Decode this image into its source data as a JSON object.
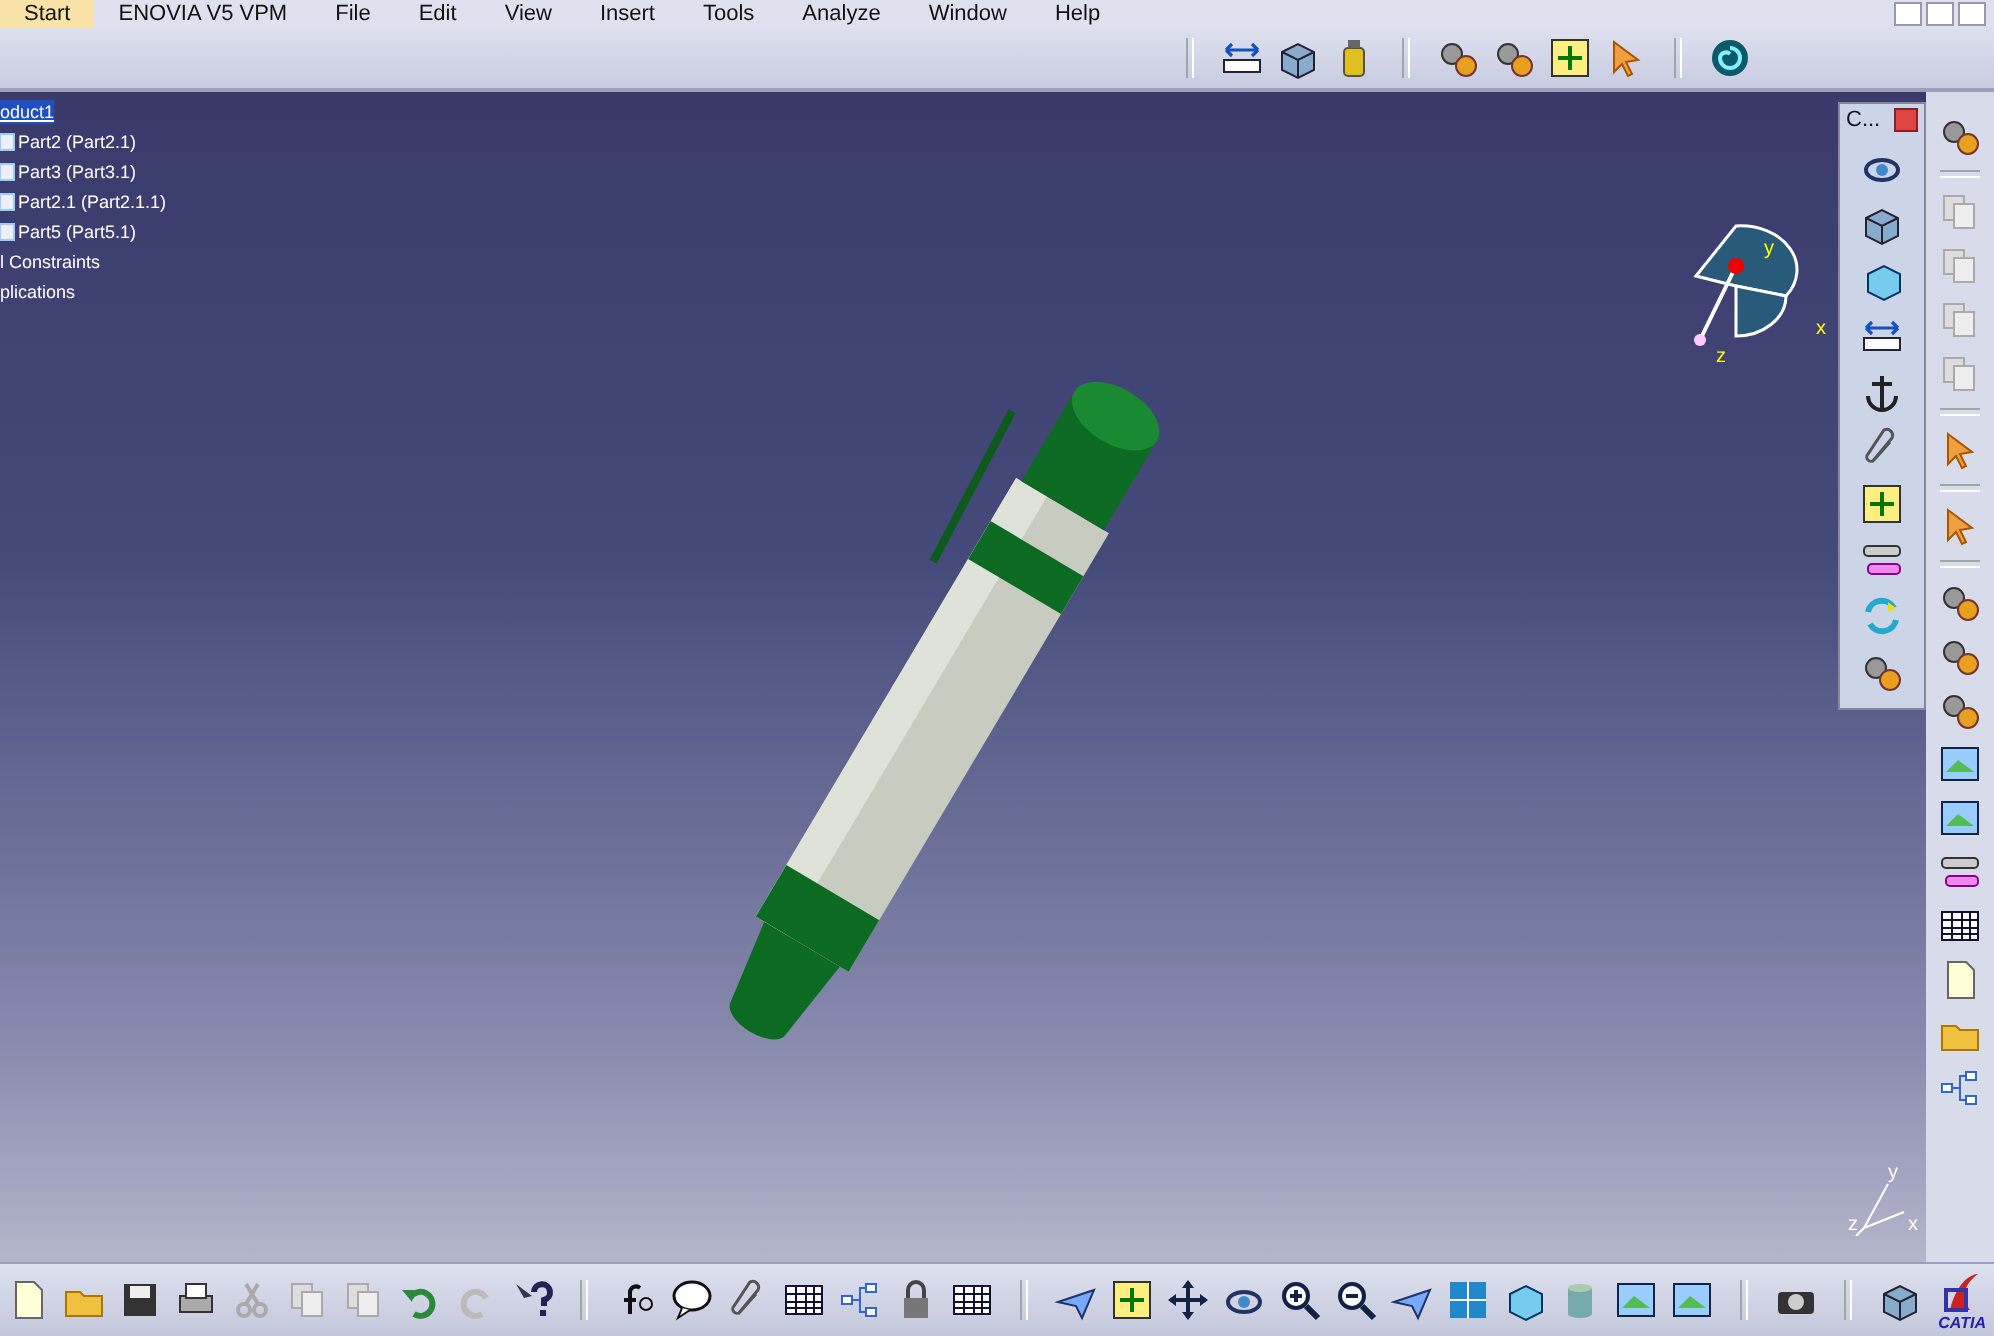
{
  "menu_bar": [
    {
      "label": "Start",
      "selected": true
    },
    {
      "label": "ENOVIA V5 VPM",
      "selected": false
    },
    {
      "label": "File",
      "selected": false
    },
    {
      "label": "Edit",
      "selected": false
    },
    {
      "label": "View",
      "selected": false
    },
    {
      "label": "Insert",
      "selected": false
    },
    {
      "label": "Tools",
      "selected": false
    },
    {
      "label": "Analyze",
      "selected": false
    },
    {
      "label": "Window",
      "selected": false
    },
    {
      "label": "Help",
      "selected": false
    }
  ],
  "tree": [
    {
      "label": "oduct1",
      "kind": "root",
      "selected": true
    },
    {
      "label": "Part2 (Part2.1)",
      "kind": "part",
      "selected": false
    },
    {
      "label": "Part3 (Part3.1)",
      "kind": "part",
      "selected": false
    },
    {
      "label": "Part2.1 (Part2.1.1)",
      "kind": "part",
      "selected": false
    },
    {
      "label": "Part5 (Part5.1)",
      "kind": "part",
      "selected": false
    },
    {
      "label": "l Constraints",
      "kind": "node",
      "selected": false
    },
    {
      "label": "plications",
      "kind": "node",
      "selected": false
    }
  ],
  "floating_toolbar": {
    "title": "C..."
  },
  "compass": {
    "labels": [
      "y",
      "x",
      "z"
    ]
  },
  "axis_triad": {
    "labels": [
      "y",
      "z",
      "x"
    ]
  },
  "logo": {
    "text": "CATIA"
  }
}
